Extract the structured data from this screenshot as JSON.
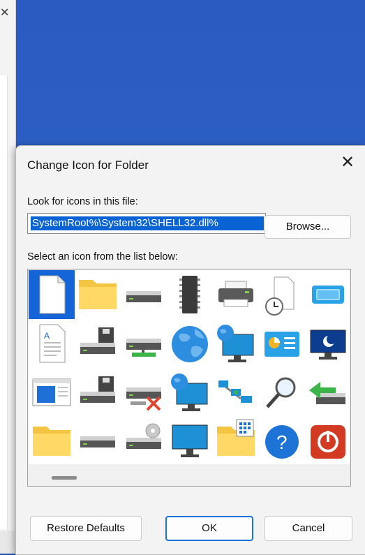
{
  "dialog": {
    "title": "Change Icon for  Folder",
    "close_glyph": "✕",
    "file_label": "Look for icons in this file:",
    "file_value": "%SystemRoot%\\System32\\SHELL32.dll",
    "browse_label": "Browse...",
    "list_label": "Select an icon from the list below:",
    "restore_label": "Restore Defaults",
    "ok_label": "OK",
    "cancel_label": "Cancel"
  },
  "background": {
    "left_window_close_glyph": "✕"
  },
  "icons": [
    "blank-document-icon",
    "folder-icon",
    "drive-icon",
    "chip-icon",
    "printer-icon",
    "clock-document-icon",
    "window-icon",
    "text-document-icon",
    "floppy-drive-icon",
    "network-drive-icon",
    "globe-icon",
    "network-monitor-icon",
    "control-panel-icon",
    "monitor-moon-icon",
    "app-window-icon",
    "floppy-drive-2-icon",
    "disconnected-drive-icon",
    "globe-monitor-icon",
    "network-connections-icon",
    "search-icon",
    "green-arrow-drive-icon",
    "folder-2-icon",
    "drive-2-icon",
    "cd-drive-icon",
    "monitor-icon",
    "folder-grid-icon",
    "help-icon",
    "power-icon"
  ]
}
